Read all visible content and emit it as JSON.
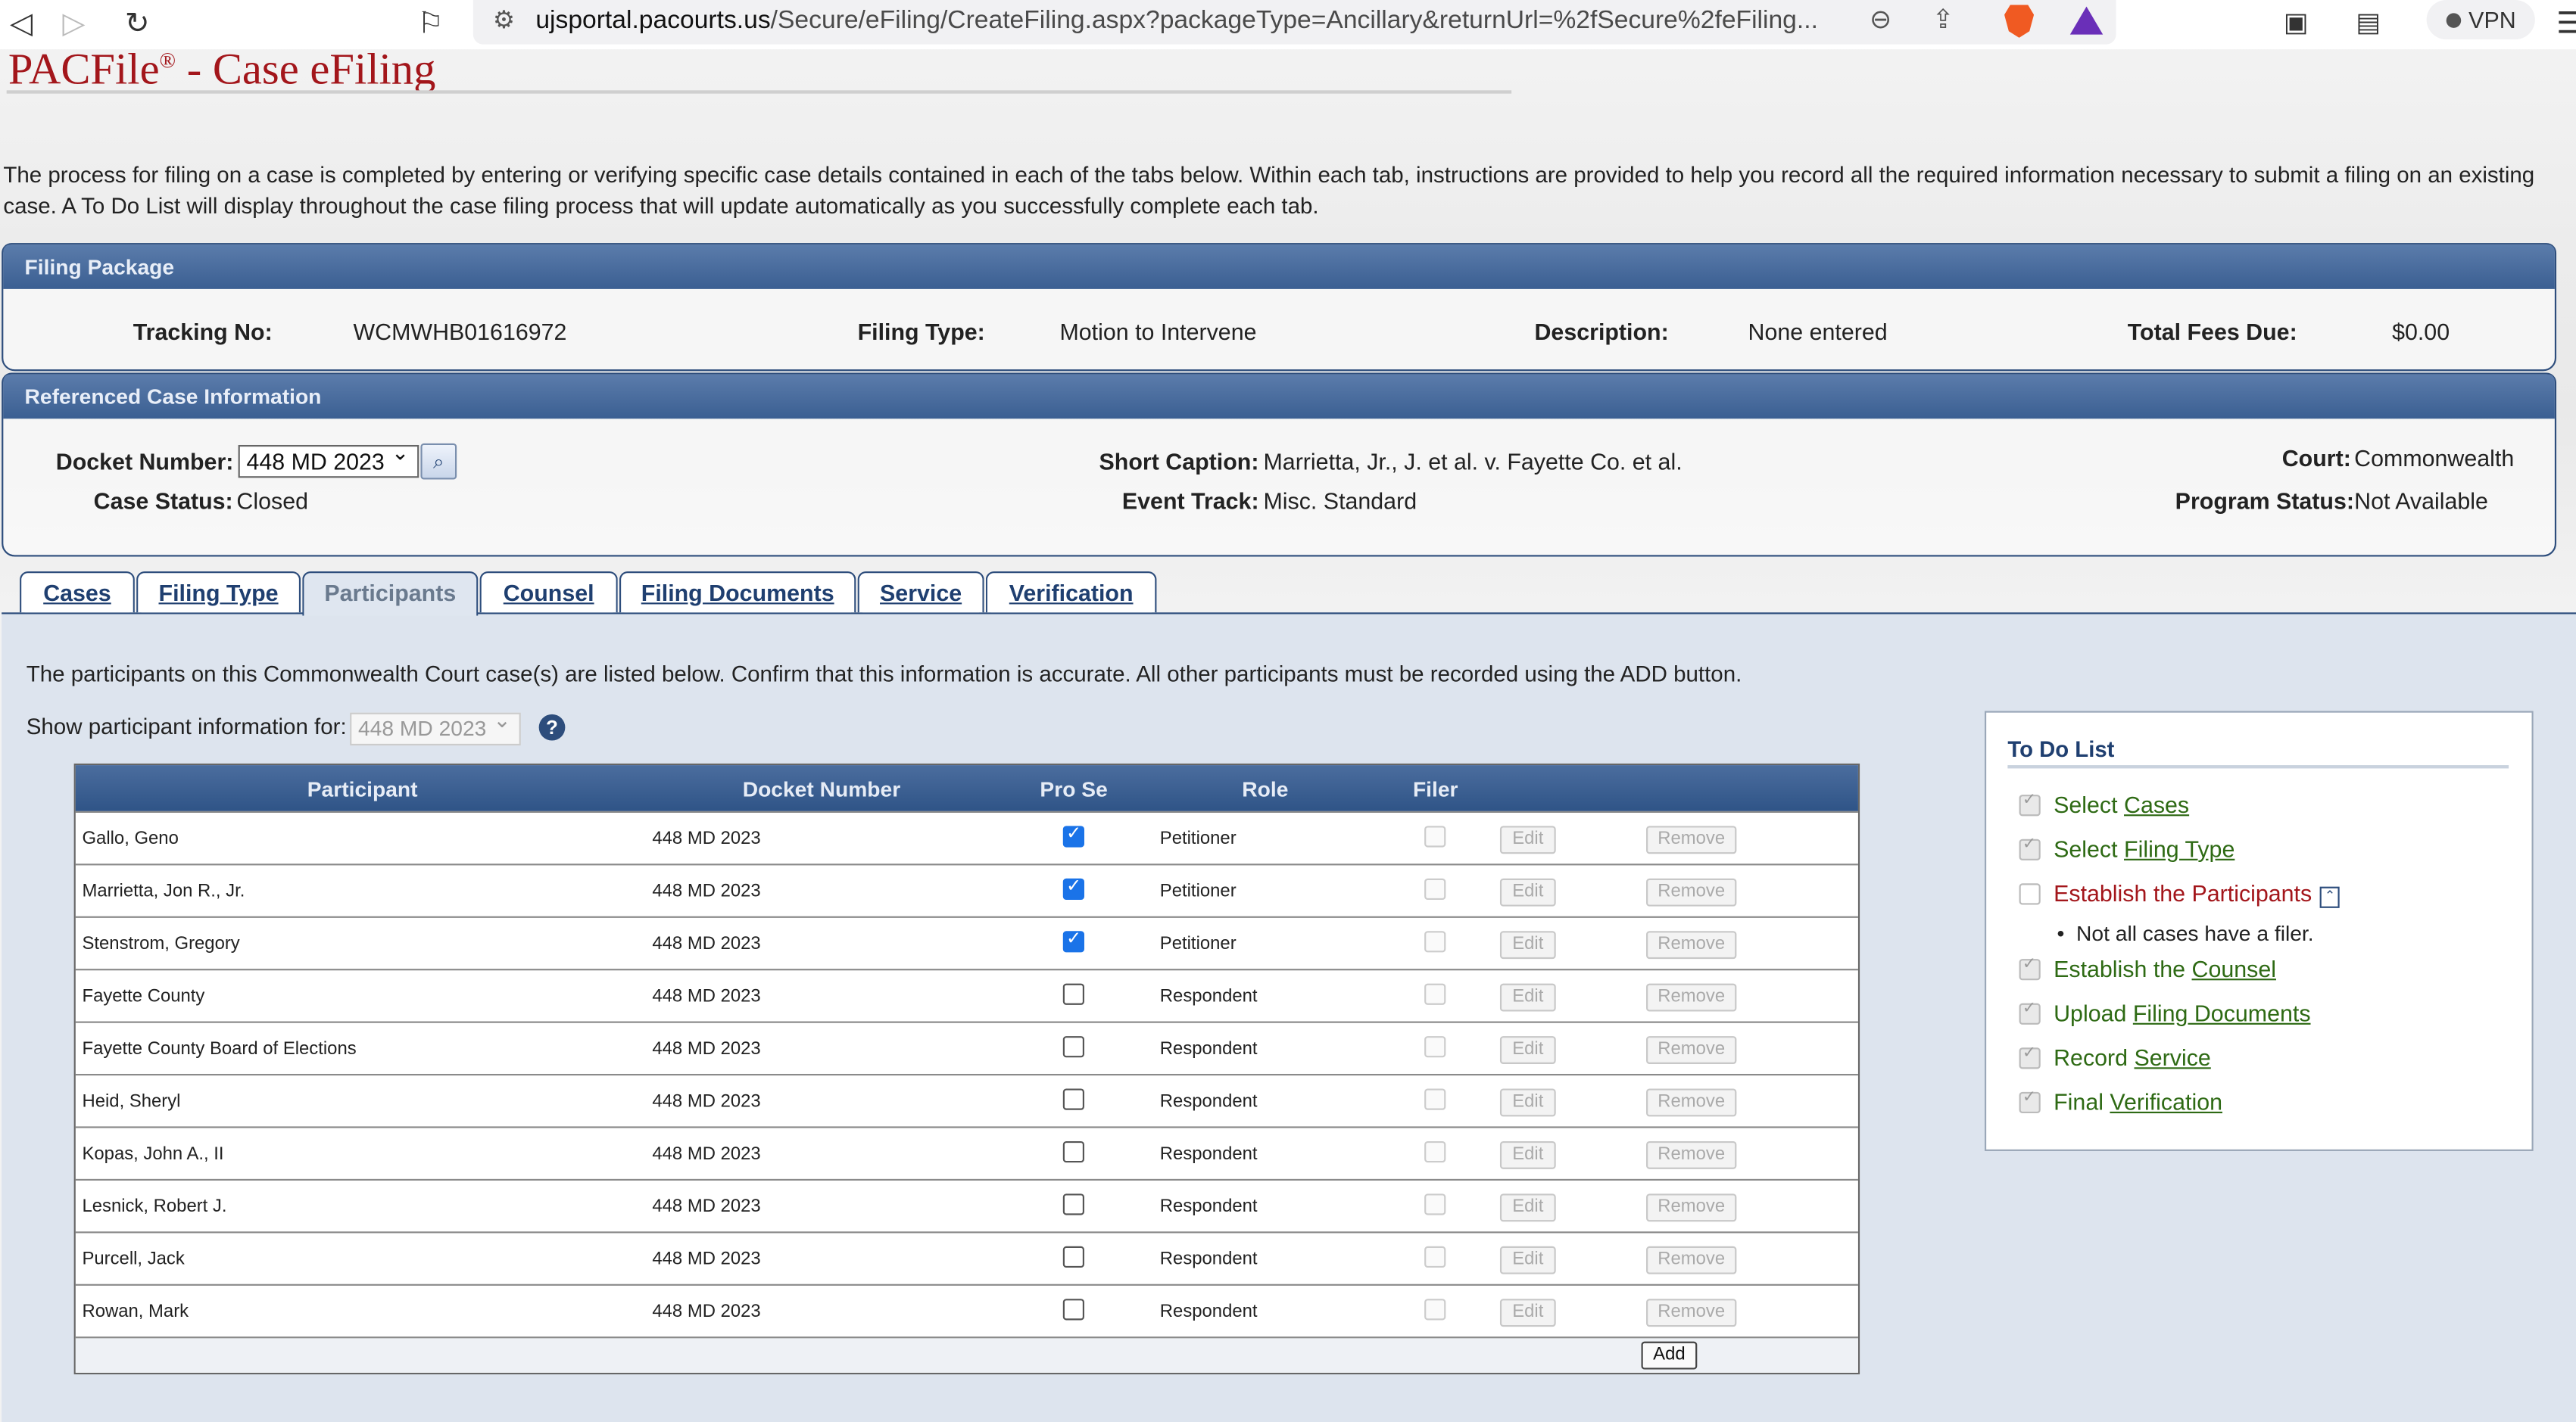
{
  "browser": {
    "url_host": "ujsportal.pacourts.us",
    "url_path": "/Secure/eFiling/CreateFiling.aspx?packageType=Ancillary&returnUrl=%2fSecure%2feFiling...",
    "vpn_label": "VPN"
  },
  "header": {
    "title_main": "PACFile",
    "title_mark": "®",
    "title_rest": " - Case eFiling"
  },
  "intro": "The process for filing on a case is completed by entering or verifying specific case details contained in each of the tabs below. Within each tab, instructions are provided to help you record all the required information necessary to submit a filing on an existing case. A To Do List will display throughout the case filing process that will update automatically as you successfully complete each tab.",
  "filing_package": {
    "header": "Filing Package",
    "tracking_label": "Tracking No:",
    "tracking_value": "WCMWHB01616972",
    "type_label": "Filing Type:",
    "type_value": "Motion to Intervene",
    "desc_label": "Description:",
    "desc_value": "None entered",
    "fees_label": "Total Fees Due:",
    "fees_value": "$0.00"
  },
  "referenced_case": {
    "header": "Referenced Case Information",
    "docket_label": "Docket Number:",
    "docket_value": "448 MD 2023",
    "status_label": "Case Status:",
    "status_value": "Closed",
    "caption_label": "Short Caption:",
    "caption_value": "Marrietta, Jr., J. et al. v. Fayette Co. et al.",
    "track_label": "Event Track:",
    "track_value": "Misc. Standard",
    "court_label": "Court:",
    "court_value": "Commonwealth",
    "program_label": "Program Status:",
    "program_value": "Not Available"
  },
  "tabs": [
    "Cases",
    "Filing Type",
    "Participants",
    "Counsel",
    "Filing Documents",
    "Service",
    "Verification"
  ],
  "participants": {
    "instructions": "The participants on this Commonwealth Court case(s) are listed below. Confirm that this information is accurate. All other participants must be recorded using the ADD button.",
    "show_label": "Show participant information for:",
    "show_value": "448 MD 2023",
    "columns": [
      "Participant",
      "Docket Number",
      "Pro Se",
      "Role",
      "Filer"
    ],
    "edit_label": "Edit",
    "remove_label": "Remove",
    "add_label": "Add",
    "rows": [
      {
        "name": "Gallo, Geno",
        "docket": "448 MD 2023",
        "pro_se": true,
        "role": "Petitioner"
      },
      {
        "name": "Marrietta, Jon R., Jr.",
        "docket": "448 MD 2023",
        "pro_se": true,
        "role": "Petitioner"
      },
      {
        "name": "Stenstrom, Gregory",
        "docket": "448 MD 2023",
        "pro_se": true,
        "role": "Petitioner"
      },
      {
        "name": "Fayette County",
        "docket": "448 MD 2023",
        "pro_se": false,
        "role": "Respondent"
      },
      {
        "name": "Fayette County Board of Elections",
        "docket": "448 MD 2023",
        "pro_se": false,
        "role": "Respondent"
      },
      {
        "name": "Heid, Sheryl",
        "docket": "448 MD 2023",
        "pro_se": false,
        "role": "Respondent"
      },
      {
        "name": "Kopas, John A., II",
        "docket": "448 MD 2023",
        "pro_se": false,
        "role": "Respondent"
      },
      {
        "name": "Lesnick, Robert J.",
        "docket": "448 MD 2023",
        "pro_se": false,
        "role": "Respondent"
      },
      {
        "name": "Purcell, Jack",
        "docket": "448 MD 2023",
        "pro_se": false,
        "role": "Respondent"
      },
      {
        "name": "Rowan, Mark",
        "docket": "448 MD 2023",
        "pro_se": false,
        "role": "Respondent"
      }
    ]
  },
  "todo": {
    "title": "To Do List",
    "items": [
      {
        "prefix": "Select ",
        "link": "Cases",
        "done": true
      },
      {
        "prefix": "Select ",
        "link": "Filing Type",
        "done": true
      },
      {
        "prefix": "Establish the Participants",
        "link": "",
        "done": false
      },
      {
        "prefix": "Establish the ",
        "link": "Counsel",
        "done": true
      },
      {
        "prefix": "Upload ",
        "link": "Filing Documents",
        "done": true
      },
      {
        "prefix": "Record ",
        "link": "Service",
        "done": true
      },
      {
        "prefix": "Final ",
        "link": "Verification",
        "done": true
      }
    ],
    "note": "Not all cases have a filer."
  },
  "colors": {
    "brand_red": "#a3161b",
    "header_blue": "#2d4d7c",
    "done_green": "#2e6a14"
  }
}
